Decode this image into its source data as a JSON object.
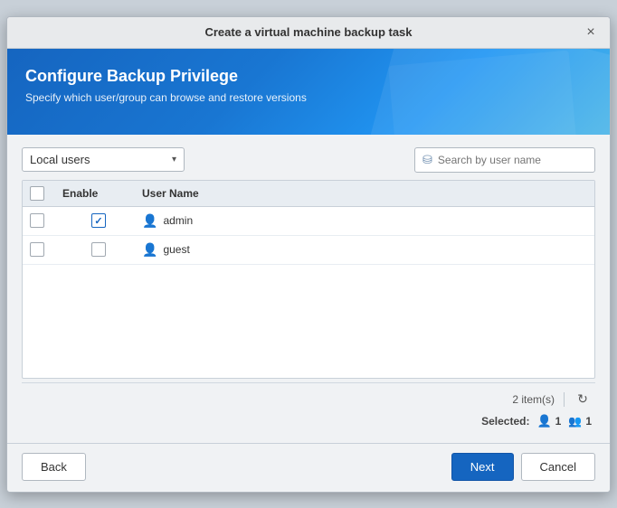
{
  "dialog": {
    "title": "Create a virtual machine backup task",
    "close_label": "×"
  },
  "banner": {
    "title": "Configure Backup Privilege",
    "subtitle": "Specify which user/group can browse and restore versions"
  },
  "toolbar": {
    "dropdown_label": "Local users",
    "dropdown_arrow": "▾",
    "search_placeholder": "Search by user name"
  },
  "table": {
    "col_enable": "Enable",
    "col_username": "User Name",
    "rows": [
      {
        "id": 1,
        "checked": true,
        "username": "admin"
      },
      {
        "id": 2,
        "checked": false,
        "username": "guest"
      }
    ]
  },
  "footer": {
    "item_count": "2 item(s)",
    "selected_label": "Selected:",
    "selected_users": "1",
    "selected_groups": "1"
  },
  "buttons": {
    "back": "Back",
    "next": "Next",
    "cancel": "Cancel"
  }
}
